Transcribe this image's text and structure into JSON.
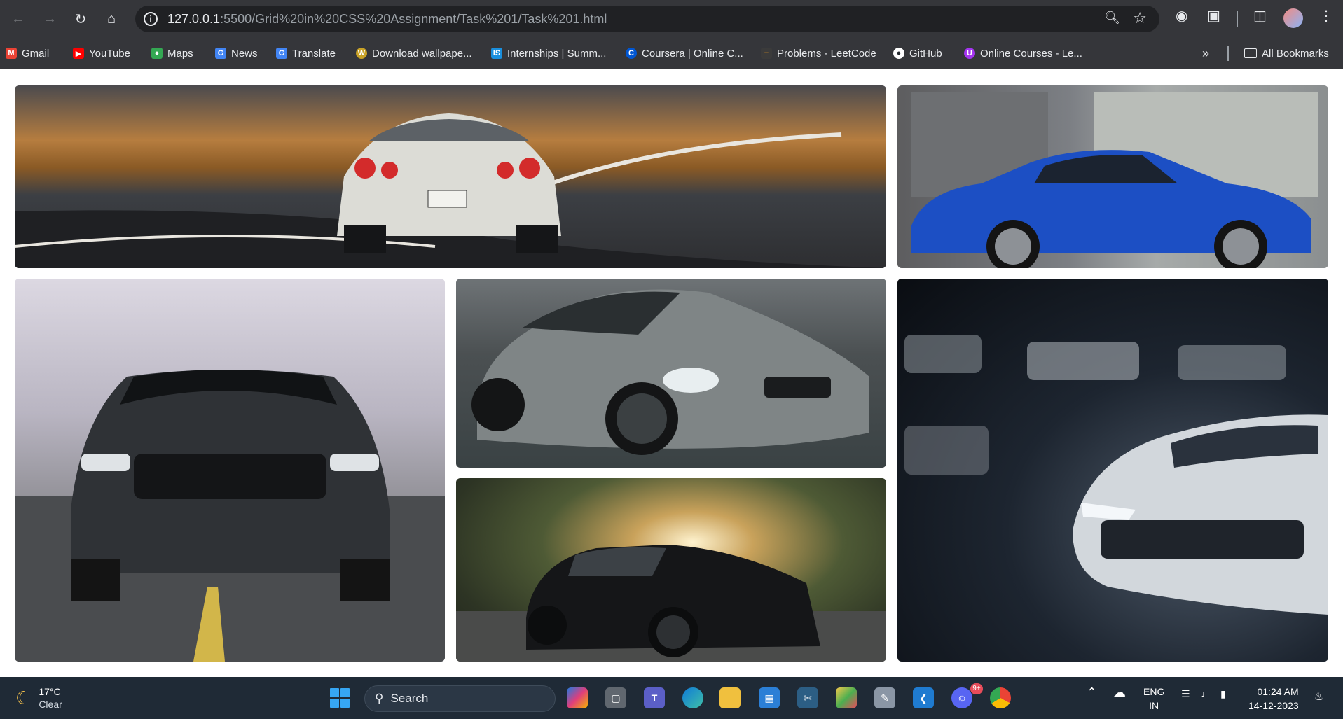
{
  "browser": {
    "url_host": "127.0.0.1",
    "url_rest": ":5500/Grid%20in%20CSS%20Assignment/Task%201/Task%201.html",
    "bookmarks": [
      {
        "label": "Gmail",
        "icon": "gmail-icon",
        "color": "#ea4335"
      },
      {
        "label": "YouTube",
        "icon": "youtube-icon",
        "color": "#ff0000"
      },
      {
        "label": "Maps",
        "icon": "maps-icon",
        "color": "#34a853"
      },
      {
        "label": "News",
        "icon": "news-icon",
        "color": "#4285f4"
      },
      {
        "label": "Translate",
        "icon": "translate-icon",
        "color": "#4285f4"
      },
      {
        "label": "Download wallpape...",
        "icon": "wallpaper-icon",
        "color": "#c9a227"
      },
      {
        "label": "Internships | Summ...",
        "icon": "internshala-icon",
        "color": "#1a8fdd"
      },
      {
        "label": "Coursera | Online C...",
        "icon": "coursera-icon",
        "color": "#0056d2"
      },
      {
        "label": "Problems - LeetCode",
        "icon": "leetcode-icon",
        "color": "#ffa116"
      },
      {
        "label": "GitHub",
        "icon": "github-icon",
        "color": "#ffffff"
      },
      {
        "label": "Online Courses - Le...",
        "icon": "udemy-icon",
        "color": "#a435f0"
      }
    ],
    "all_bookmarks_label": "All Bookmarks"
  },
  "gallery": {
    "tiles": [
      {
        "name": "white-gtr-on-road",
        "alt": "White sports car on winding road"
      },
      {
        "name": "blue-bmw-coupe",
        "alt": "Blue coupe parked"
      },
      {
        "name": "black-mustang-front",
        "alt": "Black muscle car front view"
      },
      {
        "name": "grey-bmw-m4",
        "alt": "Grey coupe"
      },
      {
        "name": "black-mustang-sunset",
        "alt": "Black muscle car at sunset"
      },
      {
        "name": "white-camaro-garage",
        "alt": "White car in dark garage"
      }
    ]
  },
  "taskbar": {
    "weather_temp": "17°C",
    "weather_cond": "Clear",
    "search_label": "Search",
    "lang_top": "ENG",
    "lang_bottom": "IN",
    "time": "01:24 AM",
    "date": "14-12-2023",
    "discord_badge": "9+"
  }
}
